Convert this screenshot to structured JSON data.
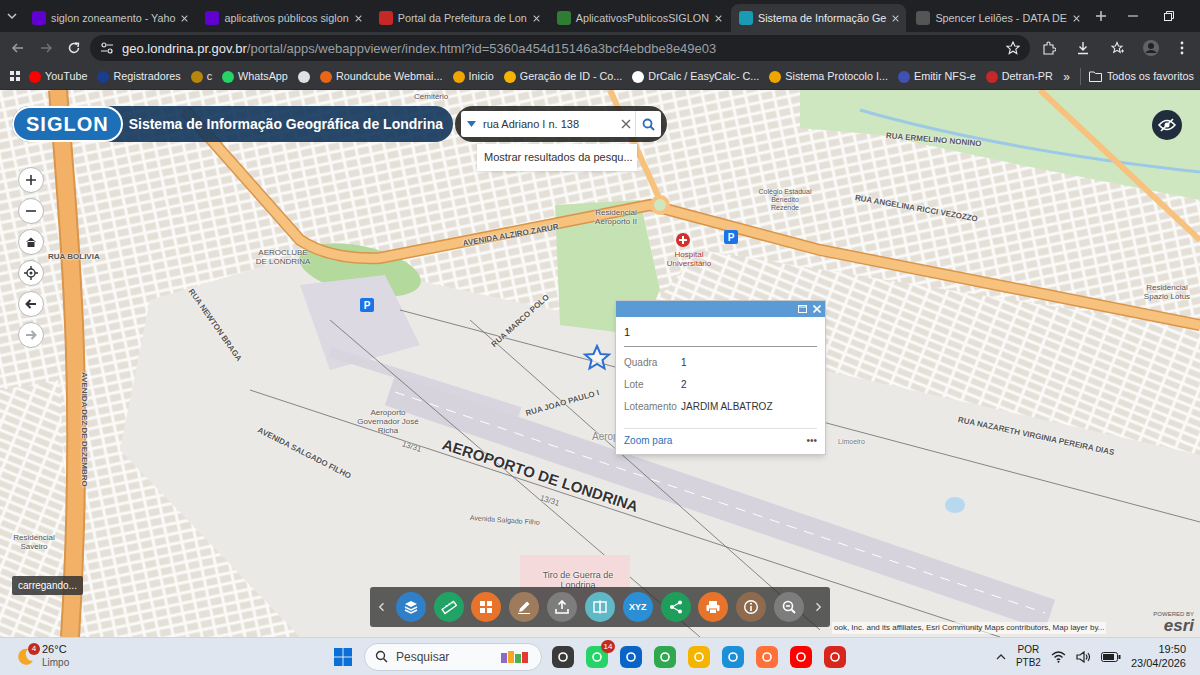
{
  "browser": {
    "tabs": [
      {
        "label": "siglon zoneamento - Yaho",
        "selected": false,
        "color": "#6001d2"
      },
      {
        "label": "aplicativos públicos siglon",
        "selected": false,
        "color": "#6001d2"
      },
      {
        "label": "Portal da Prefeitura de Lon",
        "selected": false,
        "color": "#c62828"
      },
      {
        "label": "AplicativosPublicosSIGLON",
        "selected": false,
        "color": "#2e7d32"
      },
      {
        "label": "Sistema de Informação Ge",
        "selected": true,
        "color": "#1a9bb5"
      },
      {
        "label": "Spencer Leilões - DATA DE",
        "selected": false,
        "color": "#555555"
      }
    ],
    "url": {
      "host": "geo.londrina.pr.gov.br",
      "path": "/portal/apps/webappviewer/index.html?id=5360a454d15146a3bcf4ebdbe8e49e03"
    },
    "bookmarks": [
      {
        "label": "YouTube",
        "color": "#ff0000"
      },
      {
        "label": "Registradores",
        "color": "#1b3d8f"
      },
      {
        "label": "c",
        "color": "#b8860b"
      },
      {
        "label": "WhatsApp",
        "color": "#25d366"
      },
      {
        "color": "#e0e0e0"
      },
      {
        "label": "Roundcube Webmai...",
        "color": "#e8651a"
      },
      {
        "label": "Inicio",
        "color": "#f0a500"
      },
      {
        "label": "Geração de ID - Co...",
        "color": "#f5b400"
      },
      {
        "label": "DrCalc / EasyCalc- C...",
        "color": "#ffffff"
      },
      {
        "label": "Sistema Protocolo I...",
        "color": "#f0a500"
      },
      {
        "label": "Emitir NFS-e",
        "color": "#3f51b5"
      },
      {
        "label": "Detran-PR",
        "color": "#c62828"
      }
    ],
    "more": "»",
    "all_bookmarks": "Todos os favoritos"
  },
  "app": {
    "logo": "SIGLON",
    "title": "Sistema de Informação Geográfica de Londrina",
    "search": {
      "value": "rua Adriano I n. 138",
      "suggestion": "Mostrar resultados da pesqu..."
    }
  },
  "popup": {
    "title": "1",
    "fields": [
      {
        "label": "Quadra",
        "value": "1"
      },
      {
        "label": "Lote",
        "value": "2"
      },
      {
        "label": "Loteamento",
        "value": "JARDIM ALBATROZ"
      }
    ],
    "zoom": "Zoom para",
    "more": "•••"
  },
  "map": {
    "labels": [
      {
        "text": "AEROPORTO DE LONDRINA"
      },
      {
        "text": "AVENIDA ALZIRO ZARUR"
      },
      {
        "text": "Aeroporto Governador José Richa"
      },
      {
        "text": "Hospital Universitário"
      },
      {
        "text": "Residencial Aeroporto II"
      },
      {
        "text": "AEROCLUBE DE LONDRINA"
      },
      {
        "text": "RUA BOLIVIA"
      },
      {
        "text": "AVENIDA SALGADO FILHO"
      },
      {
        "text": "Avenida Salgado Filho"
      },
      {
        "text": "RUA JOAO PAULO I"
      },
      {
        "text": "RUA MARCO POLO"
      },
      {
        "text": "Aeroporto"
      },
      {
        "text": "Tiro de Guerra de Londrina"
      },
      {
        "text": "RUA ERMELINO NONINO"
      },
      {
        "text": "RUA NAZARETH VIRGINIA PEREIRA DIAS"
      },
      {
        "text": "Colégio Estadual Benedito Rezende"
      },
      {
        "text": "Residencial Spazio Lotus"
      },
      {
        "text": "Cemitério"
      },
      {
        "text": "RUA NEWTON BRAGA"
      },
      {
        "text": "AVENIDA DEZ DE DEZEMBRO"
      },
      {
        "text": "13/31"
      },
      {
        "text": "13/31"
      },
      {
        "text": "Residencial Saveiro"
      },
      {
        "text": "RUA ANGELINA RICCI VEZOZZO"
      },
      {
        "text": "Limoeiro"
      }
    ],
    "parking": [
      {
        "text": "P"
      },
      {
        "text": "P"
      }
    ],
    "loading": "carregando...",
    "attribution": "ook, Inc. and its affiliates, Esri Community Maps contributors, Map layer by...",
    "powered": "POWERED BY",
    "esri": "esri"
  },
  "toolbar": {
    "tools": [
      {
        "kind": "layers",
        "color": "#2f80c9"
      },
      {
        "kind": "measure",
        "color": "#21a366"
      },
      {
        "kind": "grid",
        "color": "#e8742c"
      },
      {
        "kind": "draw",
        "color": "#9e7b5c"
      },
      {
        "kind": "upload",
        "color": "#7d7d7d"
      },
      {
        "kind": "split",
        "color": "#5fb8c6"
      },
      {
        "kind": "xyz",
        "color": "#2b8fd6",
        "label": "XYZ"
      },
      {
        "kind": "share",
        "color": "#1e9e5a"
      },
      {
        "kind": "print",
        "color": "#e8742c"
      },
      {
        "kind": "info",
        "color": "#8e6a4f"
      },
      {
        "kind": "search",
        "color": "#7d7d7d"
      }
    ]
  },
  "taskbar": {
    "weather": {
      "badge": "4",
      "temp": "26°C",
      "condition": "Limpo"
    },
    "search": "Pesquisar",
    "apps": [
      {
        "color": "#3a3a3a"
      },
      {
        "color": "#25d366",
        "badge": "14"
      },
      {
        "color": "#0a64c8"
      },
      {
        "color": "#2fa84f"
      },
      {
        "color": "#f4b400"
      },
      {
        "color": "#1b8fd8"
      },
      {
        "color": "#ff7139"
      },
      {
        "color": "#ff0000"
      },
      {
        "color": "#d9261c"
      }
    ],
    "lang": {
      "primary": "POR",
      "secondary": "PTB2"
    },
    "time": "19:50",
    "date": "23/04/2026"
  }
}
